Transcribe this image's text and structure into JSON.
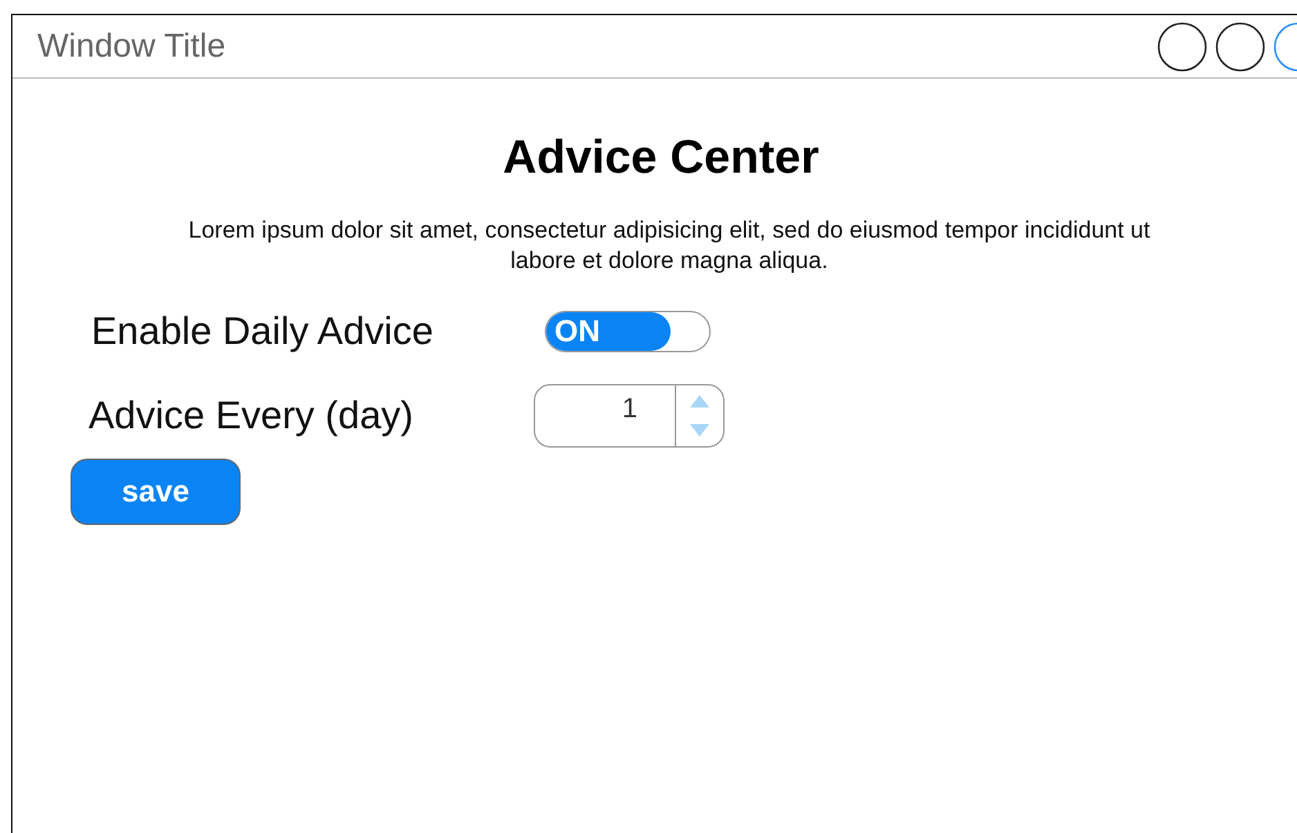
{
  "window": {
    "title": "Window Title"
  },
  "heading": "Advice Center",
  "description": "Lorem ipsum dolor sit amet, consectetur adipisicing elit, sed do eiusmod tempor incididunt ut labore et dolore magna aliqua.",
  "toggle": {
    "label": "Enable Daily Advice",
    "on": true,
    "text": "ON"
  },
  "spinner": {
    "label": "Advice Every (day)",
    "value": "1"
  },
  "button": "save"
}
